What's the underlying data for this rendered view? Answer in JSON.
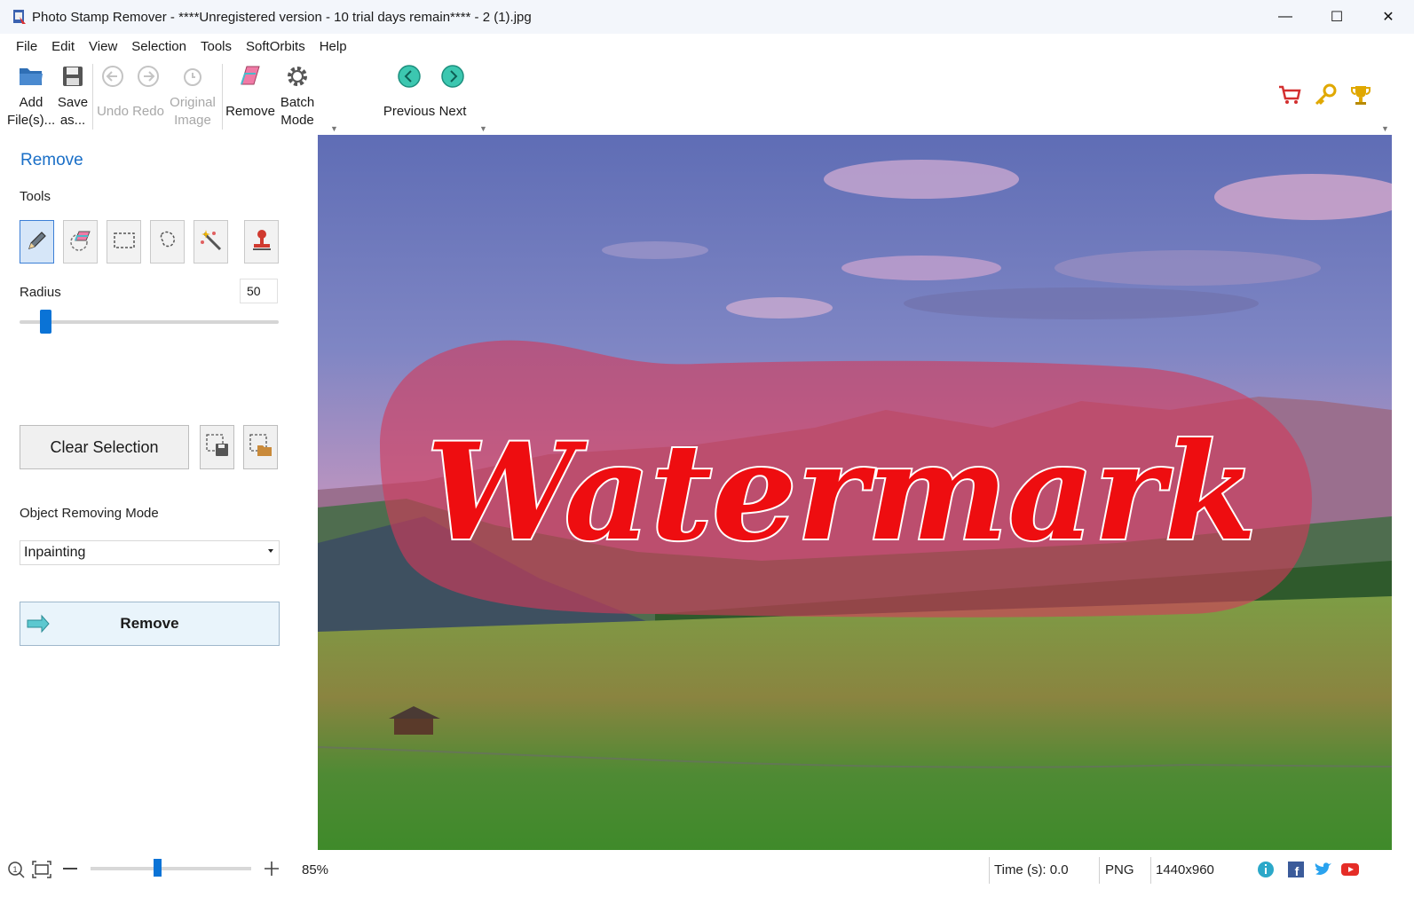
{
  "window": {
    "title": "Photo Stamp Remover - ****Unregistered version - 10 trial days remain**** - 2 (1).jpg",
    "minimize": "—",
    "maximize": "☐",
    "close": "✕"
  },
  "menu": [
    {
      "label": "File"
    },
    {
      "label": "Edit"
    },
    {
      "label": "View"
    },
    {
      "label": "Selection"
    },
    {
      "label": "Tools"
    },
    {
      "label": "SoftOrbits"
    },
    {
      "label": "Help"
    }
  ],
  "toolbar": {
    "add_files": "Add File(s)...",
    "save_as": "Save as...",
    "undo": "Undo",
    "redo": "Redo",
    "original_image": "Original Image",
    "remove": "Remove",
    "batch_mode": "Batch Mode",
    "previous": "Previous",
    "next": "Next",
    "right_icons": [
      "cart-icon",
      "key-icon",
      "trophy-icon"
    ]
  },
  "panel": {
    "title": "Remove",
    "tools_label": "Tools",
    "tools": [
      "pencil-icon",
      "eraser-icon",
      "rect-select-icon",
      "lasso-icon",
      "magic-wand-icon",
      "stamp-icon"
    ],
    "radius_label": "Radius",
    "radius_value": "50",
    "radius_fraction": 0.1,
    "clear_selection": "Clear Selection",
    "mode_label": "Object Removing Mode",
    "mode_value": "Inpainting",
    "remove_button": "Remove"
  },
  "canvas": {
    "watermark_text": "Watermark"
  },
  "status": {
    "zoom": "85%",
    "time": "Time (s): 0.0",
    "format": "PNG",
    "dimensions": "1440x960"
  },
  "colors": {
    "accent": "#0a73d6",
    "panel_title": "#1a6fc7",
    "selection_overlay": "#d23a5a",
    "watermark": "#ee0d10"
  }
}
